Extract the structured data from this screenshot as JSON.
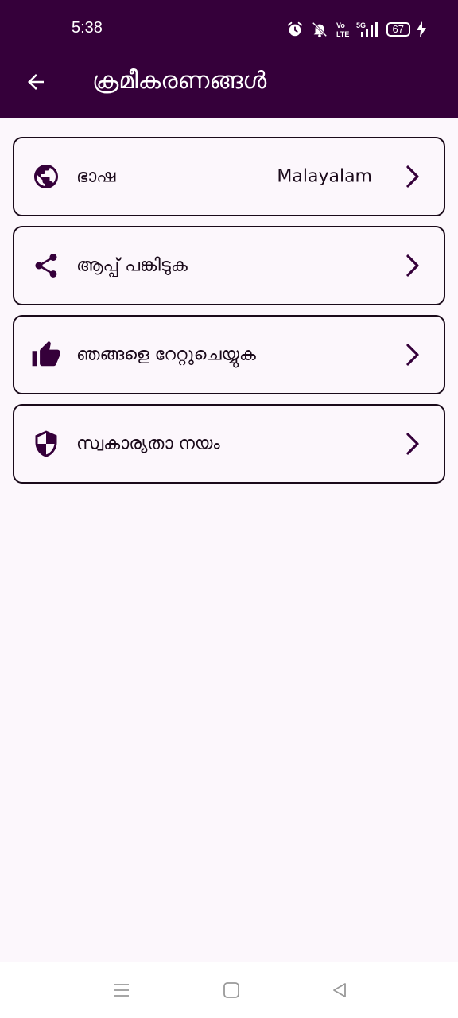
{
  "status_bar": {
    "time": "5:38",
    "battery": "67",
    "network": "5G",
    "volte": "Vo LTE"
  },
  "header": {
    "title": "ക്രമീകരണങ്ങൾ",
    "back_icon": "arrow-left-icon"
  },
  "settings": [
    {
      "label": "ഭാഷ",
      "value": "Malayalam",
      "icon": "globe-icon"
    },
    {
      "label": "ആപ്പ് പങ്കിടുക",
      "value": "",
      "icon": "share-icon"
    },
    {
      "label": "ഞങ്ങളെ റേറ്റുചെയ്യുക",
      "value": "",
      "icon": "thumb-up-icon"
    },
    {
      "label": "സ്വകാര്യതാ നയം",
      "value": "",
      "icon": "shield-icon"
    }
  ],
  "colors": {
    "primary": "#35003A",
    "background": "#FCF7FC",
    "text": "#1A0A1A"
  }
}
